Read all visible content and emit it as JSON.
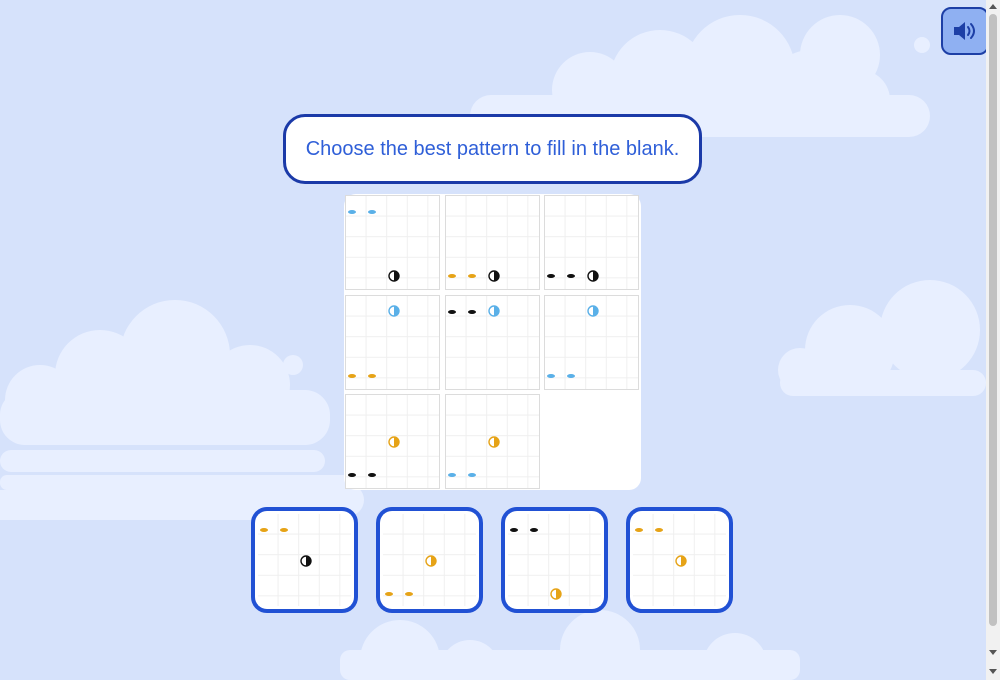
{
  "prompt": {
    "text": "Choose the best pattern to fill in the blank."
  },
  "icons": {
    "sound": "speaker-icon",
    "missing": "blank-cell"
  },
  "colors": {
    "black": "#111111",
    "blue": "#5ab0e8",
    "orange": "#e6a317",
    "accent": "#2151d4",
    "background": "#d6e2fb"
  },
  "grid": [
    {
      "dots": {
        "color": "blue",
        "row": 0,
        "col": 0
      },
      "half": {
        "color": "black",
        "row": 3,
        "col": 2
      }
    },
    {
      "dots": {
        "color": "orange",
        "row": 3,
        "col": 0
      },
      "half": {
        "color": "black",
        "row": 3,
        "col": 2
      }
    },
    {
      "dots": {
        "color": "black",
        "row": 2,
        "col": 0
      },
      "half": {
        "color": "black",
        "row": 3,
        "col": 2
      }
    },
    {
      "dots": {
        "color": "orange",
        "row": 2,
        "col": 0
      },
      "half": {
        "color": "blue",
        "row": 0,
        "col": 2
      }
    },
    {
      "dots": {
        "color": "black",
        "row": 0,
        "col": 0
      },
      "half": {
        "color": "blue",
        "row": 0,
        "col": 2
      }
    },
    {
      "dots": {
        "color": "blue",
        "row": 3,
        "col": 0
      },
      "half": {
        "color": "blue",
        "row": 0,
        "col": 2
      }
    },
    {
      "dots": {
        "color": "black",
        "row": 3,
        "col": 0
      },
      "half": {
        "color": "orange",
        "row": 2,
        "col": 2
      }
    },
    {
      "dots": {
        "color": "blue",
        "row": 2,
        "col": 0
      },
      "half": {
        "color": "orange",
        "row": 2,
        "col": 2
      }
    },
    null
  ],
  "options": [
    {
      "dots": {
        "color": "orange",
        "row": 0,
        "col": 0
      },
      "half": {
        "color": "black",
        "row": 2,
        "col": 2
      }
    },
    {
      "dots": {
        "color": "orange",
        "row": 3,
        "col": 0
      },
      "half": {
        "color": "orange",
        "row": 2,
        "col": 2
      }
    },
    {
      "dots": {
        "color": "black",
        "row": 0,
        "col": 0
      },
      "half": {
        "color": "orange",
        "row": 3,
        "col": 2
      }
    },
    {
      "dots": {
        "color": "orange",
        "row": 0,
        "col": 0
      },
      "half": {
        "color": "orange",
        "row": 2,
        "col": 2
      }
    }
  ]
}
